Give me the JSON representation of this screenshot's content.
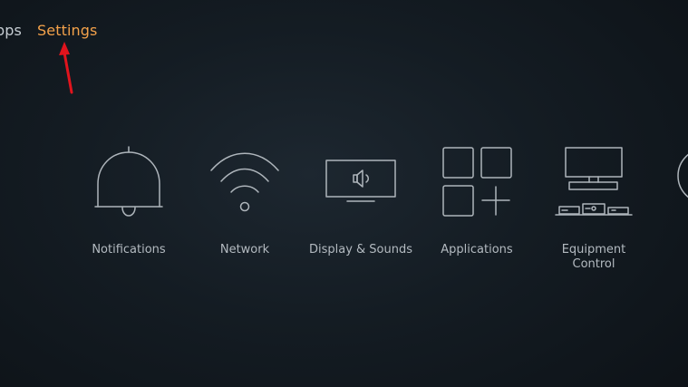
{
  "nav": {
    "apps_label": "pps",
    "settings_label": "Settings"
  },
  "colors": {
    "selected_nav": "#f3a14a",
    "annotation_arrow": "#e0141d"
  },
  "tiles": [
    {
      "label": "Notifications",
      "icon": "bell-icon"
    },
    {
      "label": "Network",
      "icon": "wifi-icon"
    },
    {
      "label": "Display & Sounds",
      "icon": "tv-speaker-icon"
    },
    {
      "label": "Applications",
      "icon": "apps-grid-icon"
    },
    {
      "label": "Equipment\nControl",
      "icon": "equipment-icon"
    }
  ]
}
